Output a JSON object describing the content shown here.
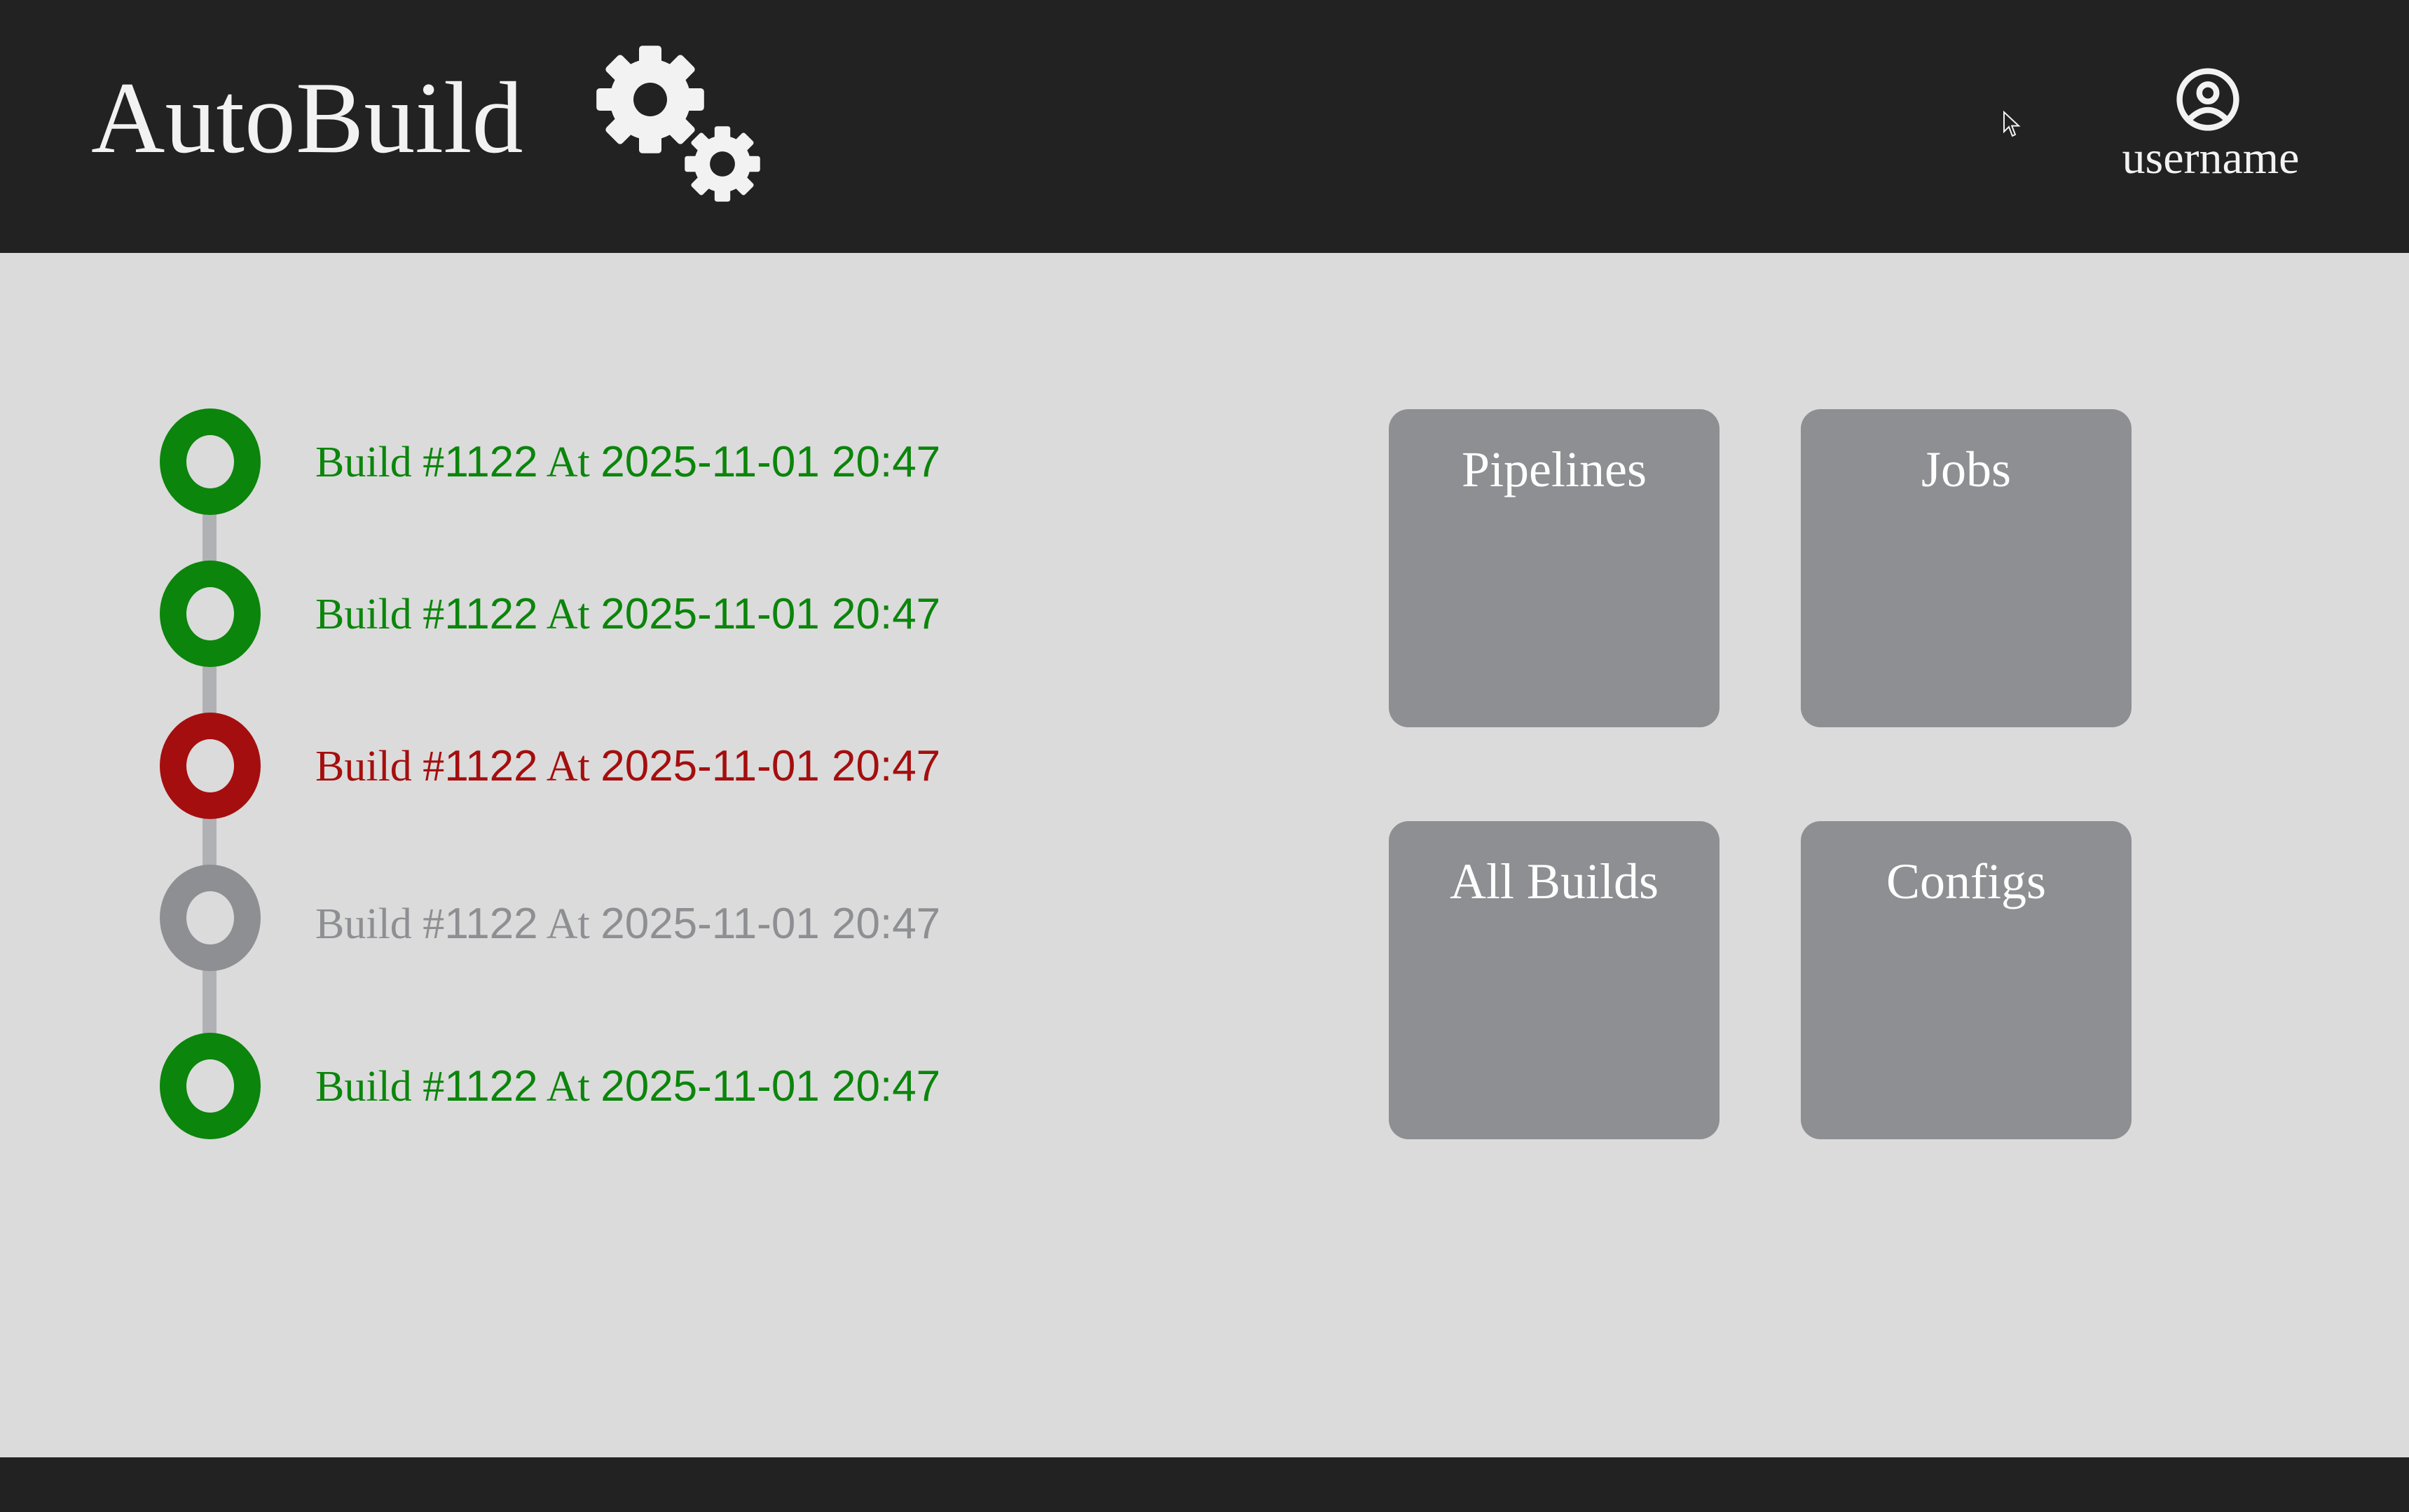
{
  "app": {
    "title": "AutoBuild"
  },
  "user": {
    "name": "username",
    "icon": "user-circle-icon"
  },
  "colors": {
    "header_bg": "#222222",
    "page_bg": "#dbdbdb",
    "success": "#0b850b",
    "failed": "#a50e0e",
    "pending": "#8e8f92",
    "tile_bg": "#8e8f92"
  },
  "builds": [
    {
      "prefix": "Build #",
      "number": "1122",
      "at": " At ",
      "timestamp": "2025-11-01 20:47",
      "status": "success"
    },
    {
      "prefix": "Build #",
      "number": "1122",
      "at": " At ",
      "timestamp": "2025-11-01 20:47",
      "status": "success"
    },
    {
      "prefix": "Build #",
      "number": "1122",
      "at": " At ",
      "timestamp": "2025-11-01 20:47",
      "status": "failed"
    },
    {
      "prefix": "Build #",
      "number": "1122",
      "at": " At ",
      "timestamp": "2025-11-01 20:47",
      "status": "pending"
    },
    {
      "prefix": "Build #",
      "number": "1122",
      "at": " At ",
      "timestamp": "2025-11-01 20:47",
      "status": "success"
    }
  ],
  "tiles": [
    {
      "label": "Pipelines"
    },
    {
      "label": "Jobs"
    },
    {
      "label": "All Builds"
    },
    {
      "label": "Configs"
    }
  ]
}
